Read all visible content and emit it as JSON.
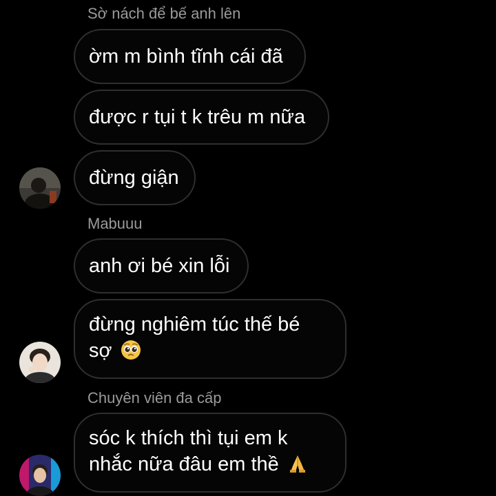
{
  "colors": {
    "background": "#000000",
    "bubble_border": "#2f2f2f",
    "sender_text": "#9a9a9a",
    "message_text": "#ffffff"
  },
  "groups": [
    {
      "sender": "Sờ nách để bế anh lên",
      "avatar": "user-avatar-dark-hair",
      "messages": [
        "ờm m bình tĩnh cái đã",
        "được r tụi t k trêu m nữa",
        "đừng giận"
      ]
    },
    {
      "sender": "Mabuuu",
      "avatar": "user-avatar-light-hair",
      "messages": [
        "anh ơi bé xin lỗi",
        "đừng nghiêm túc thế bé",
        "sợ"
      ],
      "emoji": "pleading-face-icon"
    },
    {
      "sender": "Chuyên viên đa cấp",
      "avatar": "user-avatar-neon",
      "messages": [
        "sóc k thích thì tụi em k",
        "nhắc nữa đâu em thề"
      ],
      "emoji": "folded-hands-icon"
    }
  ]
}
